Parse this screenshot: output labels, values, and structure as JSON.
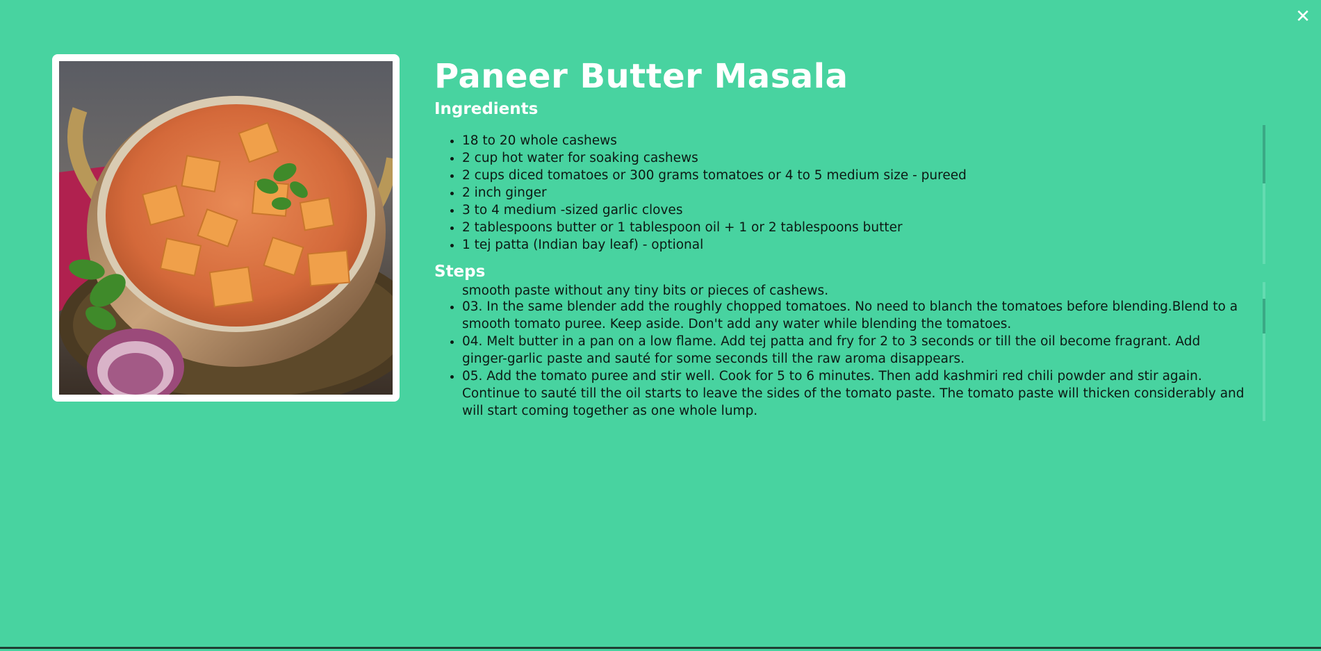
{
  "recipe": {
    "title": "Paneer Butter Masala",
    "image_alt": "Paneer butter masala in a copper bowl"
  },
  "close_label": "✕",
  "ingredients": {
    "heading": "Ingredients",
    "items": [
      "18 to 20 whole cashews",
      "2 cup hot water for soaking cashews",
      "2 cups diced tomatoes or 300 grams tomatoes or 4 to 5 medium size - pureed",
      "2 inch ginger",
      "3 to 4 medium -sized garlic cloves",
      "2 tablespoons butter or 1 tablespoon oil + 1 or 2 tablespoons butter",
      "1 tej patta (Indian bay leaf) - optional"
    ]
  },
  "steps": {
    "heading": "Steps",
    "partial_line": "smooth paste without any tiny bits or pieces of cashews.",
    "items": [
      "03. In the same blender add the roughly chopped tomatoes. No need to blanch the tomatoes before blending.Blend to a smooth tomato puree. Keep aside. Don't add any water while blending the tomatoes.",
      "04. Melt butter in a pan on a low flame. Add tej patta and fry for 2 to 3 seconds or till the oil become fragrant. Add ginger-garlic paste and sauté for some seconds till the raw aroma disappears.",
      "05. Add the tomato puree and stir well. Cook for 5 to 6 minutes. Then add kashmiri red chili powder and stir again. Continue to sauté till the oil starts to leave the sides of the tomato paste. The tomato paste will thicken considerably and will start coming together as one whole lump."
    ]
  },
  "colors": {
    "background": "#48d3a0",
    "heading": "#ffffff",
    "body_text": "#0d1a14"
  }
}
